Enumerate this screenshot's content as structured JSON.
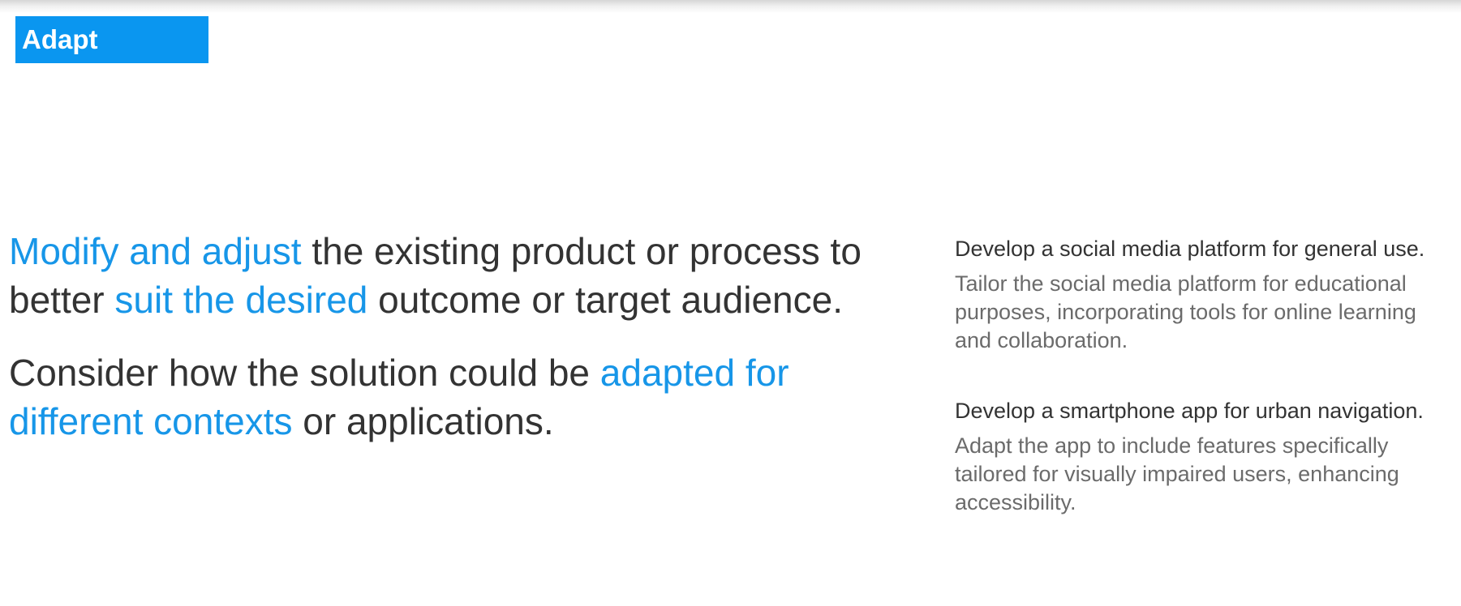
{
  "header": {
    "tag_label": "Adapt"
  },
  "main": {
    "para1": {
      "highlight1": "Modify and adjust",
      "text1": " the existing product or process to better ",
      "highlight2": "suit the desired",
      "text2": " outcome or target audience."
    },
    "para2": {
      "text1": "Consider how the solution could be ",
      "highlight1": "adapted for different contexts",
      "text2": " or applications."
    }
  },
  "examples": [
    {
      "title": "Develop a social media platform for general use.",
      "description": "Tailor the social media platform for educational purposes, incorporating tools for online learning and collaboration."
    },
    {
      "title": "Develop a smartphone app for urban navigation.",
      "description": "Adapt the app to include features specifically tailored for visually impaired users, enhancing accessibility."
    }
  ],
  "colors": {
    "accent": "#0a96f0",
    "highlight_text": "#1796e8",
    "body_text": "#333333",
    "secondary_text": "#6b6b6b"
  }
}
